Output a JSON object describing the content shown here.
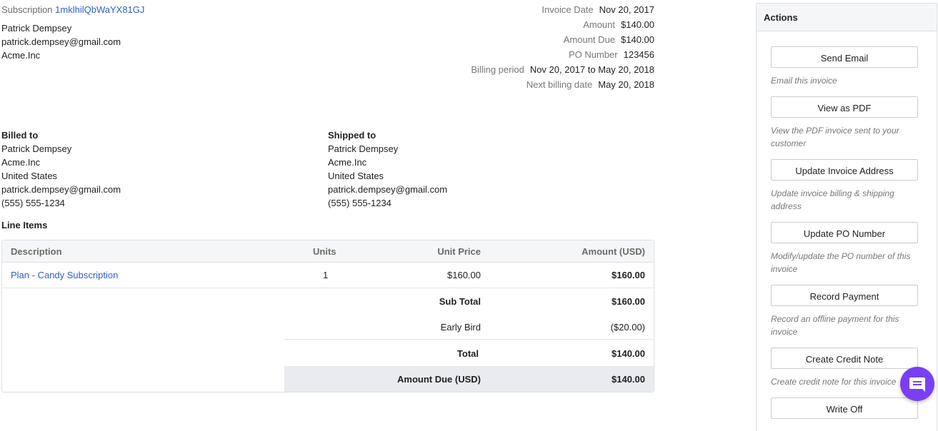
{
  "subscription": {
    "label": "Subscription",
    "id": "1mklhilQbWaYX81GJ"
  },
  "customer": {
    "name": "Patrick Dempsey",
    "email": "patrick.dempsey@gmail.com",
    "company": "Acme.Inc"
  },
  "invoice_meta": [
    {
      "label": "Invoice Date",
      "value": "Nov 20, 2017"
    },
    {
      "label": "Amount",
      "value": "$140.00"
    },
    {
      "label": "Amount Due",
      "value": "$140.00"
    },
    {
      "label": "PO Number",
      "value": "123456"
    },
    {
      "label": "Billing period",
      "value": "Nov 20, 2017 to May 20, 2018"
    },
    {
      "label": "Next billing date",
      "value": "May 20, 2018"
    }
  ],
  "billed_to": {
    "heading": "Billed to",
    "lines": [
      "Patrick Dempsey",
      "Acme.Inc",
      "United States",
      "patrick.dempsey@gmail.com",
      "(555) 555-1234"
    ]
  },
  "shipped_to": {
    "heading": "Shipped to",
    "lines": [
      "Patrick Dempsey",
      "Acme.Inc",
      "United States",
      "patrick.dempsey@gmail.com",
      "(555) 555-1234"
    ]
  },
  "line_items": {
    "title": "Line Items",
    "columns": [
      "Description",
      "Units",
      "Unit Price",
      "Amount (USD)"
    ],
    "rows": [
      {
        "description": "Plan - Candy Subscription",
        "units": "1",
        "unit_price": "$160.00",
        "amount": "$160.00"
      }
    ],
    "sub_total": {
      "label": "Sub Total",
      "value": "$160.00"
    },
    "discount": {
      "label": "Early Bird",
      "value": "($20.00)"
    },
    "total": {
      "label": "Total",
      "value": "$140.00"
    },
    "amount_due": {
      "label": "Amount Due (USD)",
      "value": "$140.00"
    }
  },
  "actions": {
    "title": "Actions",
    "items": [
      {
        "label": "Send Email",
        "description": "Email this invoice"
      },
      {
        "label": "View as PDF",
        "description": "View the PDF invoice sent to your customer"
      },
      {
        "label": "Update Invoice Address",
        "description": "Update invoice billing & shipping address"
      },
      {
        "label": "Update PO Number",
        "description": "Modify/update the PO number of this invoice"
      },
      {
        "label": "Record Payment",
        "description": "Record an offline payment for this invoice"
      },
      {
        "label": "Create Credit Note",
        "description": "Create credit note for this invoice"
      },
      {
        "label": "Write Off",
        "description": ""
      }
    ]
  },
  "chat": {
    "icon": "chat-icon",
    "color": "#7b3ff2"
  },
  "colors": {
    "link": "#2f5fc4",
    "accent": "#7b3ff2"
  }
}
